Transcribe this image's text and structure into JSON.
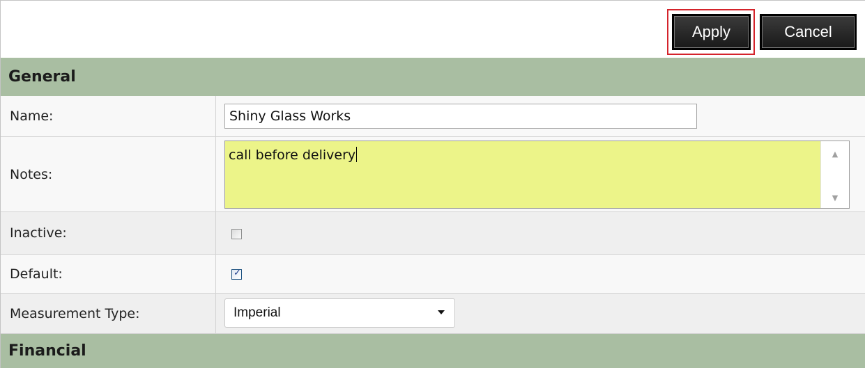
{
  "toolbar": {
    "apply_label": "Apply",
    "cancel_label": "Cancel"
  },
  "sections": {
    "general": "General",
    "financial": "Financial"
  },
  "fields": {
    "name": {
      "label": "Name:",
      "value": "Shiny Glass Works"
    },
    "notes": {
      "label": "Notes:",
      "value": "call before delivery"
    },
    "inactive": {
      "label": "Inactive:",
      "checked": false
    },
    "default": {
      "label": "Default:",
      "checked": true,
      "check_glyph": "✓"
    },
    "measurement_type": {
      "label": "Measurement Type:",
      "value": "Imperial"
    }
  },
  "icons": {
    "scroll_up": "▲",
    "scroll_down": "▼"
  },
  "colors": {
    "section_header_bg": "#a9bea2",
    "notes_bg": "#ecf489",
    "highlight_border": "#d4232b",
    "button_bg": "#2a2a2a"
  }
}
